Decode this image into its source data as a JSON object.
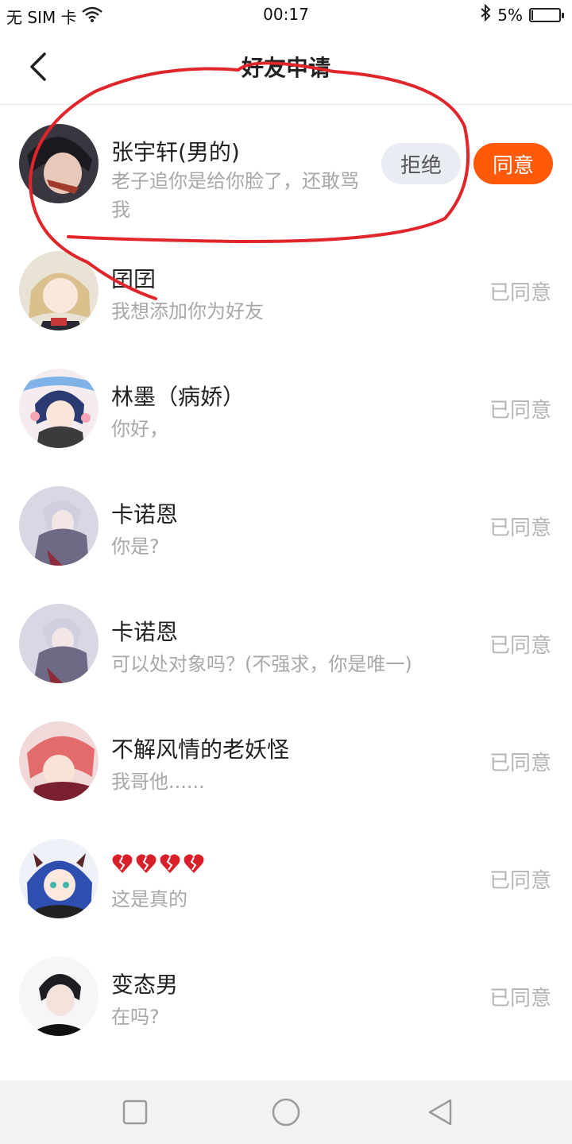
{
  "status_bar": {
    "carrier": "无 SIM 卡",
    "time": "00:17",
    "battery": "5%",
    "battery_level": 0.05,
    "icons": [
      "wifi-icon",
      "bluetooth-icon",
      "battery-icon"
    ]
  },
  "header": {
    "title": "好友申请",
    "back_icon": "chevron-left-icon"
  },
  "requests": [
    {
      "name": "张宇轩(男的)",
      "message": "老子追你是给你脸了，还敢骂我",
      "reject_label": "拒绝",
      "accept_label": "同意"
    },
    {
      "name": "囝囝",
      "message": "我想添加你为好友",
      "status": "已同意"
    },
    {
      "name": "林墨（病娇）",
      "message": "你好，",
      "status": "已同意"
    },
    {
      "name": "卡诺恩",
      "message": "你是?",
      "status": "已同意"
    },
    {
      "name": "卡诺恩",
      "message": "可以处对象吗？(不强求，你是唯一)",
      "status": "已同意"
    },
    {
      "name": "不解风情的老妖怪",
      "message": "我哥他......",
      "status": "已同意"
    },
    {
      "name": "💔💔💔💔",
      "name_icons": [
        "broken-heart-icon",
        "broken-heart-icon",
        "broken-heart-icon",
        "broken-heart-icon"
      ],
      "message": "这是真的",
      "status": "已同意"
    },
    {
      "name": "变态男",
      "message": "在吗?",
      "status": "已同意"
    }
  ],
  "system_nav": [
    "square-icon",
    "circle-icon",
    "triangle-back-icon"
  ],
  "colors": {
    "accent": "#ff5a0a",
    "annotation": "#e0262b",
    "muted": "#b5b5b5"
  }
}
